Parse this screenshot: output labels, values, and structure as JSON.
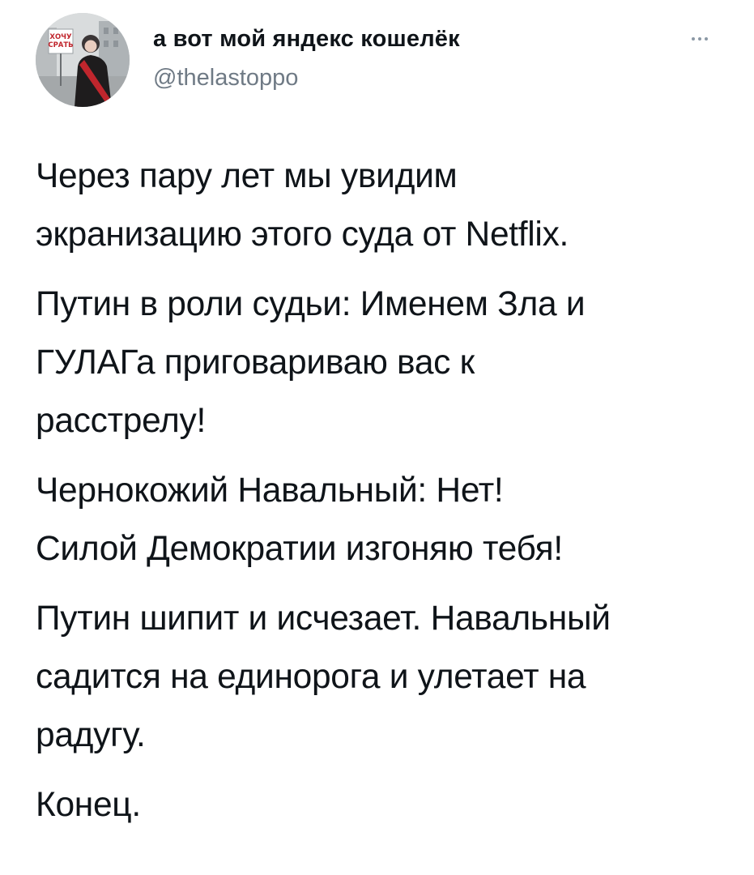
{
  "tweet": {
    "author": {
      "display_name": "а вот мой яндекс кошелёк",
      "handle": "@thelastoppo",
      "avatar_sign_text": "ХОЧУ СРАТЬ"
    },
    "more_icon": "ellipsis-icon",
    "paragraphs": [
      "Через пару лет мы увидим\nэкранизацию этого суда от Netflix.",
      "Путин в роли судьи: Именем Зла и\nГУЛАГа приговариваю вас к\nрасстрелу!",
      "Чернокожий Навальный: Нет!\nСилой Демократии изгоняю тебя!",
      "Путин шипит и исчезает. Навальный\nсадится на единорога и улетает на\nрадугу.",
      "Конец."
    ]
  },
  "colors": {
    "text": "#0f1419",
    "secondary_text": "#6f7a85",
    "background": "#ffffff",
    "sign_red": "#c0262d"
  }
}
